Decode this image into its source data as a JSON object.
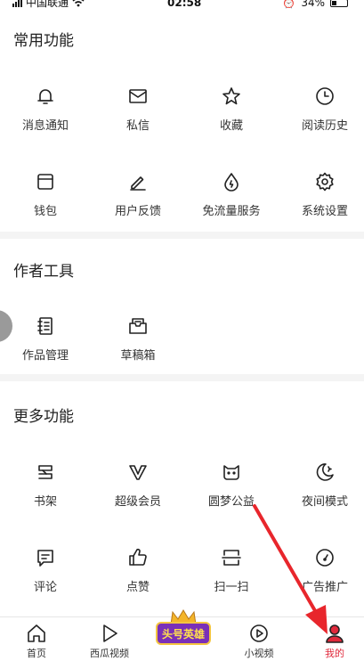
{
  "status_bar": {
    "carrier": "中国联通",
    "time": "02:58",
    "battery": "34%"
  },
  "sections": [
    {
      "title": "常用功能",
      "items": [
        {
          "label": "消息通知",
          "icon": "bell-icon"
        },
        {
          "label": "私信",
          "icon": "mail-icon"
        },
        {
          "label": "收藏",
          "icon": "star-icon"
        },
        {
          "label": "阅读历史",
          "icon": "clock-icon"
        },
        {
          "label": "钱包",
          "icon": "wallet-icon"
        },
        {
          "label": "用户反馈",
          "icon": "edit-icon"
        },
        {
          "label": "免流量服务",
          "icon": "drop-icon"
        },
        {
          "label": "系统设置",
          "icon": "gear-icon"
        }
      ]
    },
    {
      "title": "作者工具",
      "items": [
        {
          "label": "作品管理",
          "icon": "notebook-icon"
        },
        {
          "label": "草稿箱",
          "icon": "inbox-icon"
        }
      ]
    },
    {
      "title": "更多功能",
      "items": [
        {
          "label": "书架",
          "icon": "bookshelf-icon"
        },
        {
          "label": "超级会员",
          "icon": "vip-icon"
        },
        {
          "label": "圆梦公益",
          "icon": "cat-icon"
        },
        {
          "label": "夜间模式",
          "icon": "moon-icon"
        },
        {
          "label": "评论",
          "icon": "comment-icon"
        },
        {
          "label": "点赞",
          "icon": "thumbs-up-icon"
        },
        {
          "label": "扫一扫",
          "icon": "scan-icon"
        },
        {
          "label": "广告推广",
          "icon": "gauge-icon"
        }
      ]
    }
  ],
  "tabbar": [
    {
      "label": "首页",
      "icon": "home-icon"
    },
    {
      "label": "西瓜视频",
      "icon": "play-icon"
    },
    {
      "label": "头号英雄",
      "icon": "hero-badge-icon"
    },
    {
      "label": "小视频",
      "icon": "small-video-icon"
    },
    {
      "label": "我的",
      "icon": "profile-icon"
    }
  ],
  "colors": {
    "accent": "#e02a3c",
    "arrow": "#e8262c",
    "divider": "#f4f4f4"
  }
}
